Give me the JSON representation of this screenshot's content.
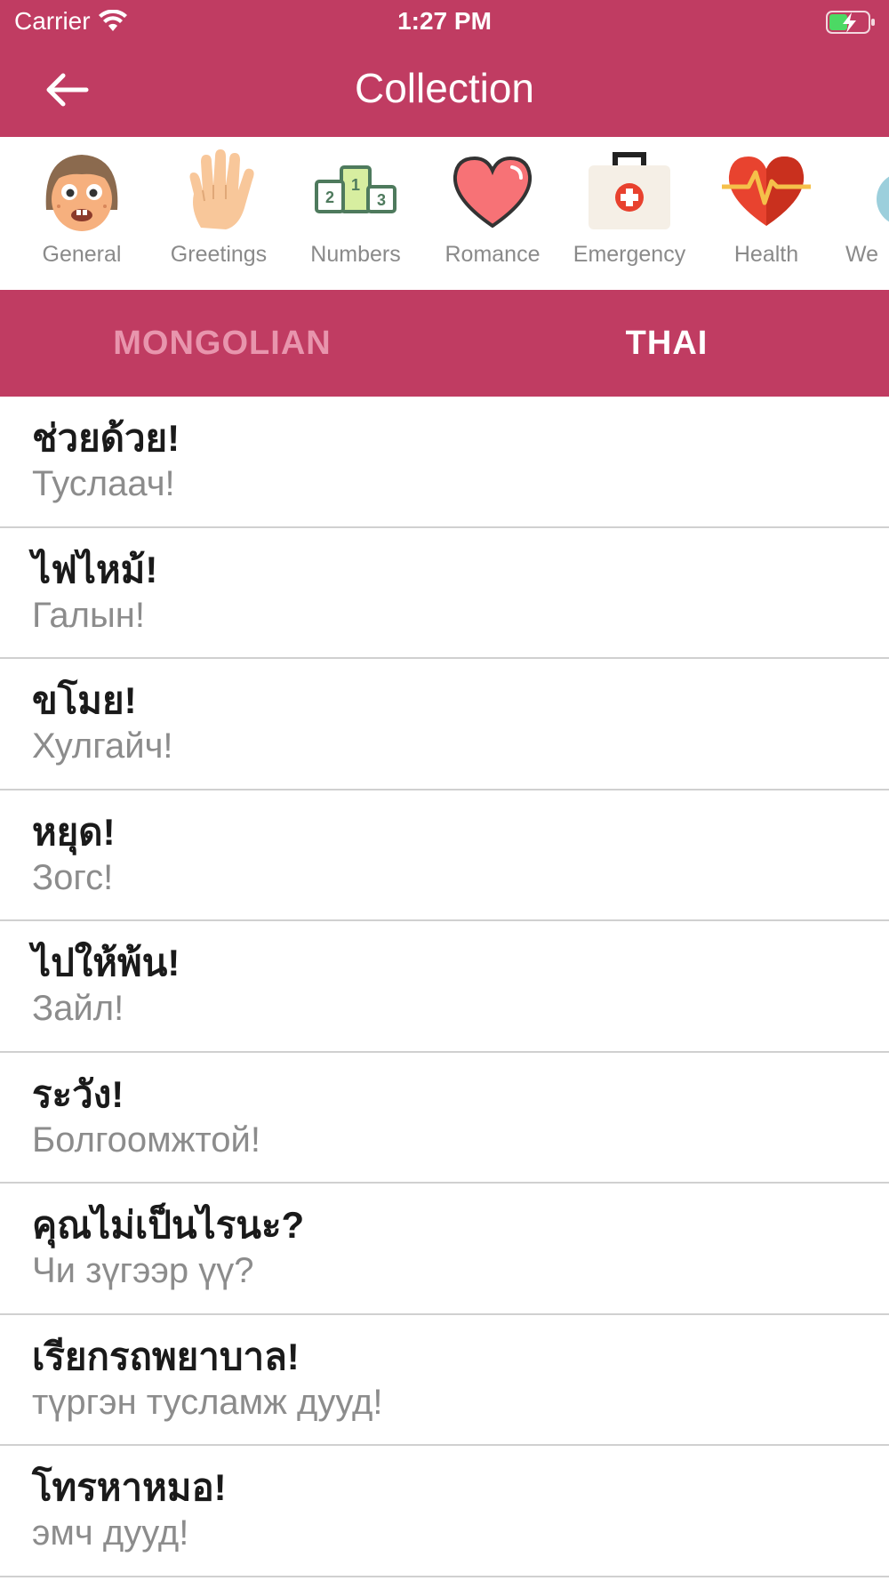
{
  "status": {
    "carrier": "Carrier",
    "time": "1:27 PM"
  },
  "header": {
    "title": "Collection",
    "back_icon": "arrow-left-icon"
  },
  "categories": [
    {
      "label": "General",
      "icon": "face-icon"
    },
    {
      "label": "Greetings",
      "icon": "hand-icon"
    },
    {
      "label": "Numbers",
      "icon": "podium-icon"
    },
    {
      "label": "Romance",
      "icon": "heart-icon"
    },
    {
      "label": "Emergency",
      "icon": "first-aid-kit-icon"
    },
    {
      "label": "Health",
      "icon": "heartbeat-icon"
    },
    {
      "label": "We",
      "icon": "weather-icon"
    }
  ],
  "tabs": [
    {
      "label": "MONGOLIAN",
      "active": false
    },
    {
      "label": "THAI",
      "active": true
    }
  ],
  "phrases": [
    {
      "primary": "ช่วยด้วย!",
      "secondary": "Туслаач!"
    },
    {
      "primary": "ไฟไหม้!",
      "secondary": "Галын!"
    },
    {
      "primary": "ขโมย!",
      "secondary": "Хулгайч!"
    },
    {
      "primary": "หยุด!",
      "secondary": "Зогс!"
    },
    {
      "primary": "ไปให้พ้น!",
      "secondary": "Зайл!"
    },
    {
      "primary": "ระวัง!",
      "secondary": "Болгоомжтой!"
    },
    {
      "primary": "คุณไม่เป็นไรนะ?",
      "secondary": "Чи зүгээр үү?"
    },
    {
      "primary": "เรียกรถพยาบาล!",
      "secondary": "түргэн тусламж дууд!"
    },
    {
      "primary": "โทรหาหมอ!",
      "secondary": "эмч дууд!"
    }
  ],
  "colors": {
    "brand": "#c03c62",
    "tab_inactive": "#e895ad",
    "tab_active": "#ffffff",
    "phrase_primary": "#1a1a1a",
    "phrase_secondary": "#8c8c8c"
  }
}
